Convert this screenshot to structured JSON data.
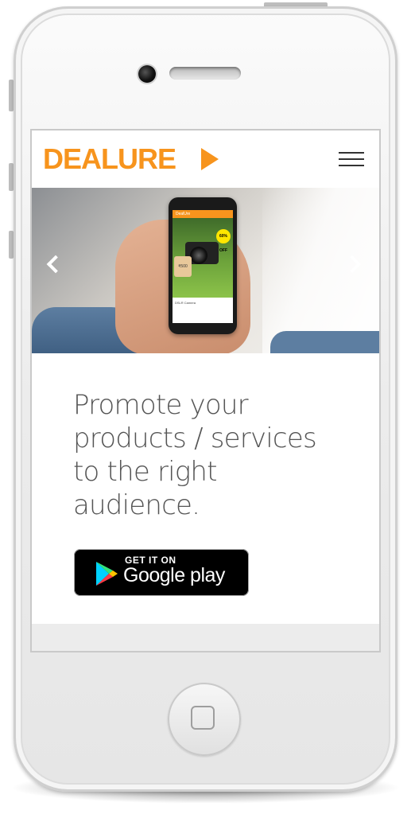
{
  "brand": {
    "logo_text": "DEALURE",
    "accent_color": "#f7941d"
  },
  "navbar": {
    "menu_icon": "hamburger-menu-icon"
  },
  "carousel": {
    "prev_icon": "chevron-left-icon",
    "next_icon": "chevron-right-icon",
    "slide_phone": {
      "app_title": "DealUre",
      "badge": "60% OFF",
      "price_tag": "₹500",
      "caption": "DSLR Camera"
    }
  },
  "hero": {
    "headline": "Promote your products / services to the right audience."
  },
  "store_badge": {
    "small_text": "GET IT ON",
    "big_text": "Google play",
    "icon": "google-play-icon"
  }
}
